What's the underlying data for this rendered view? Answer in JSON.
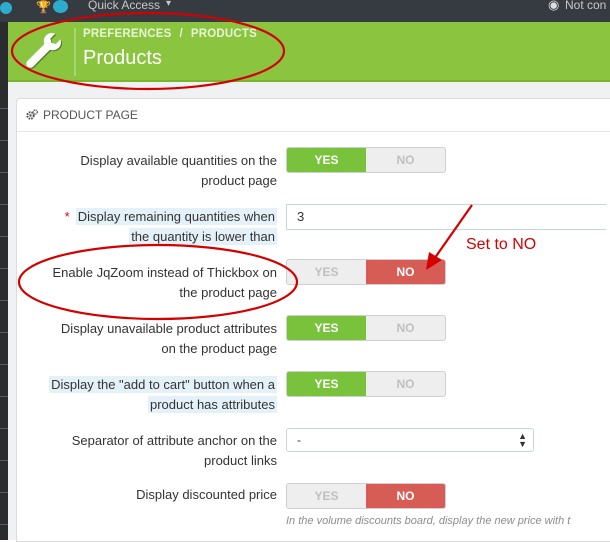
{
  "topbar": {
    "quick_access": "Quick Access",
    "caret": "▾",
    "not_connected": "Not con",
    "eye_glyph": "◉"
  },
  "header": {
    "breadcrumb": [
      "PREFERENCES",
      "PRODUCTS"
    ],
    "breadcrumb_sep": "/",
    "title": "Products",
    "accent_color": "#8bc53f"
  },
  "panel": {
    "title": "PRODUCT PAGE"
  },
  "form": {
    "rows": [
      {
        "label_l1": "Display available quantities on the",
        "label_l2": "product page",
        "yes": "YES",
        "no": "NO",
        "value": "yes"
      },
      {
        "label_l1": "Display remaining quantities when",
        "label_l2": "the quantity is lower than",
        "required": "*",
        "input_value": "3"
      },
      {
        "label_l1": "Enable JqZoom instead of Thickbox on",
        "label_l2": "the product page",
        "yes": "YES",
        "no": "NO",
        "value": "no"
      },
      {
        "label_l1": "Display unavailable product attributes",
        "label_l2": "on the product page",
        "yes": "YES",
        "no": "NO",
        "value": "yes"
      },
      {
        "label_l1": "Display the \"add to cart\" button when a",
        "label_l2": "product has attributes",
        "yes": "YES",
        "no": "NO",
        "value": "yes"
      },
      {
        "label_l1": "Separator of attribute anchor on the",
        "label_l2": "product links",
        "select_value": "-"
      },
      {
        "label_l1": "Display discounted price",
        "yes": "YES",
        "no": "NO",
        "value": "no",
        "help": "In the volume discounts board, display the new price with t"
      }
    ]
  },
  "annotation": {
    "text": "Set to NO",
    "color": "#d40000"
  }
}
